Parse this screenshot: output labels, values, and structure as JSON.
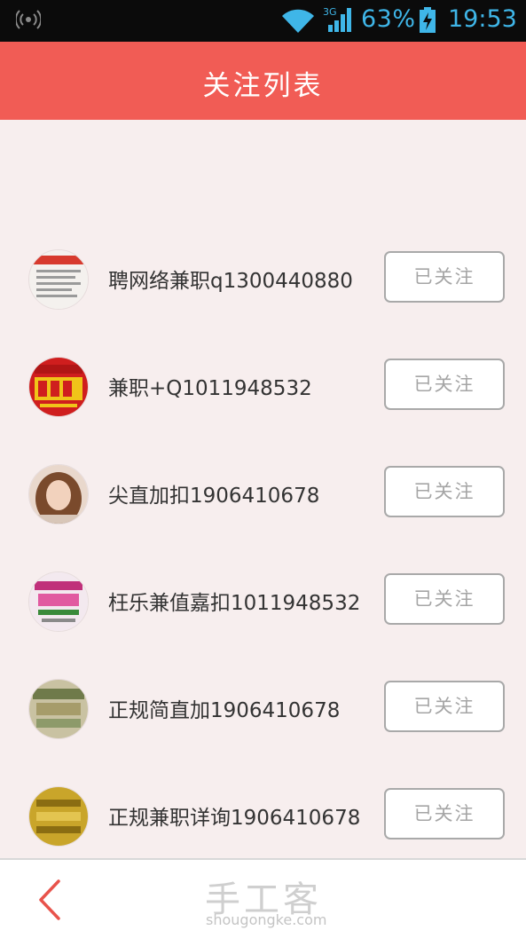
{
  "status_bar": {
    "network_type": "3G",
    "battery_percent": "63%",
    "time": "19:53"
  },
  "header": {
    "title": "关注列表"
  },
  "list": [
    {
      "name": "聘网络兼职q1300440880",
      "button": "已关注",
      "avatar": "poster-white"
    },
    {
      "name": "兼职+Q1011948532",
      "button": "已关注",
      "avatar": "poster-red"
    },
    {
      "name": "尖直加扣1906410678",
      "button": "已关注",
      "avatar": "portrait"
    },
    {
      "name": "枉乐兼值嘉扣1011948532",
      "button": "已关注",
      "avatar": "poster-pink"
    },
    {
      "name": "正规简直加1906410678",
      "button": "已关注",
      "avatar": "poster-green"
    },
    {
      "name": "正规兼职详询1906410678",
      "button": "已关注",
      "avatar": "poster-gold"
    }
  ],
  "bottom": {
    "watermark_logo": "手工客",
    "watermark_url": "shougongke.com"
  },
  "colors": {
    "header": "#f15c55",
    "background": "#f7eeee",
    "status_icons": "#3fb6e8",
    "back_arrow": "#e8534b"
  }
}
